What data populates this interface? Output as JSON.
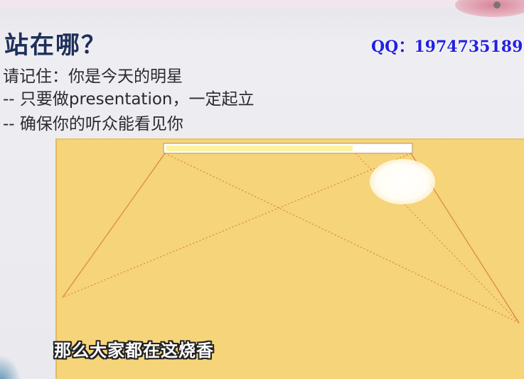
{
  "slide": {
    "title": "站在哪？",
    "contact": "QQ：1974735189",
    "lines": [
      "请记住：你是今天的明星",
      "-- 只要做presentation，一定起立",
      "-- 确保你的听众能看见你"
    ]
  },
  "diagram": {
    "room_color": "#f6d479",
    "line_color": "#d9834a",
    "screen_bar_color": "#fdf6a0"
  },
  "video": {
    "subtitle": "那么大家都在这烧香"
  }
}
